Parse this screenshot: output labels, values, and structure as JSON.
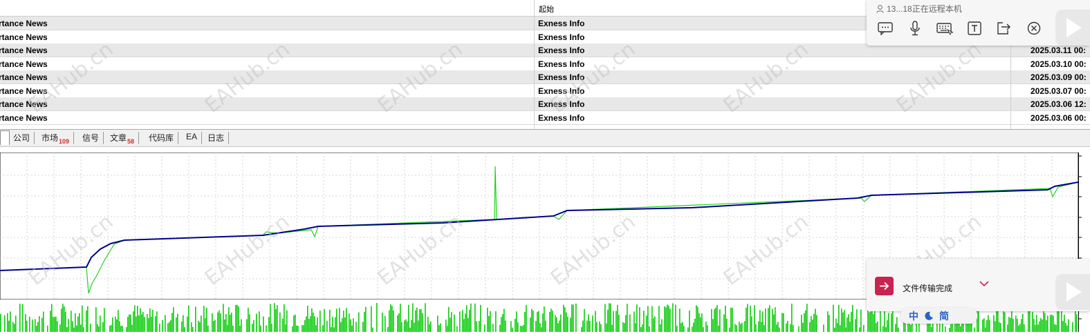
{
  "news_table": {
    "header": {
      "col_start": "起始"
    },
    "rows": [
      {
        "title": "rtance News",
        "source": "Exness Info",
        "date": ""
      },
      {
        "title": "rtance News",
        "source": "Exness Info",
        "date": ""
      },
      {
        "title": "rtance News",
        "source": "Exness Info",
        "date": "2025.03.11 00:"
      },
      {
        "title": "rtance News",
        "source": "Exness Info",
        "date": "2025.03.10 00:"
      },
      {
        "title": "rtance News",
        "source": "Exness Info",
        "date": "2025.03.09 00:"
      },
      {
        "title": "rtance News",
        "source": "Exness Info",
        "date": "2025.03.07 00:"
      },
      {
        "title": "rtance News",
        "source": "Exness Info",
        "date": "2025.03.06 12:"
      },
      {
        "title": "rtance News",
        "source": "Exness Info",
        "date": "2025.03.06 00:"
      }
    ]
  },
  "tabs": [
    {
      "label": "公司",
      "badge": ""
    },
    {
      "label": "市场",
      "badge": "109"
    },
    {
      "label": "信号",
      "badge": ""
    },
    {
      "label": "文章",
      "badge": "58"
    },
    {
      "label": "代码库",
      "badge": ""
    },
    {
      "label": "EA",
      "badge": ""
    },
    {
      "label": "日志",
      "badge": ""
    }
  ],
  "remote_popup": {
    "status": "13...18正在远程本机",
    "icons": [
      "chat-icon",
      "microphone-icon",
      "keyboard-icon",
      "text-icon",
      "exit-icon",
      "close-icon"
    ]
  },
  "file_transfer": {
    "message": "文件传输完成"
  },
  "ime": {
    "mode": "中",
    "variant": "简"
  },
  "watermark": "EAHub.cn",
  "colors": {
    "balance": "#00008b",
    "equity": "#1ed31e",
    "volume": "#0ccc0c",
    "badge": "#d12d2d",
    "file_icon": "#c9234f"
  }
}
